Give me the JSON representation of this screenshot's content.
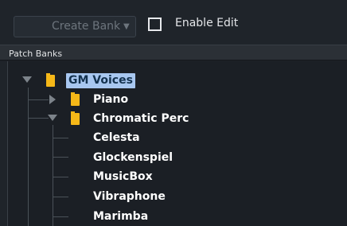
{
  "toolbar": {
    "create_bank_label": "Create Bank",
    "create_bank_caret": "▼",
    "enable_edit_label": "Enable Edit",
    "enable_edit_checked": false
  },
  "panel": {
    "title": "Patch Banks"
  },
  "tree": {
    "root": {
      "label": "GM Voices",
      "expanded": true,
      "selected": true
    },
    "piano": {
      "label": "Piano",
      "expanded": false
    },
    "chromatic": {
      "label": "Chromatic Perc",
      "expanded": true
    },
    "patches": [
      "Celesta",
      "Glockenspiel",
      "MusicBox",
      "Vibraphone",
      "Marimba"
    ]
  },
  "colors": {
    "background": "#1b1f25",
    "folder": "#f6b818",
    "selection": "#a8c7f0",
    "text": "#ffffff"
  }
}
